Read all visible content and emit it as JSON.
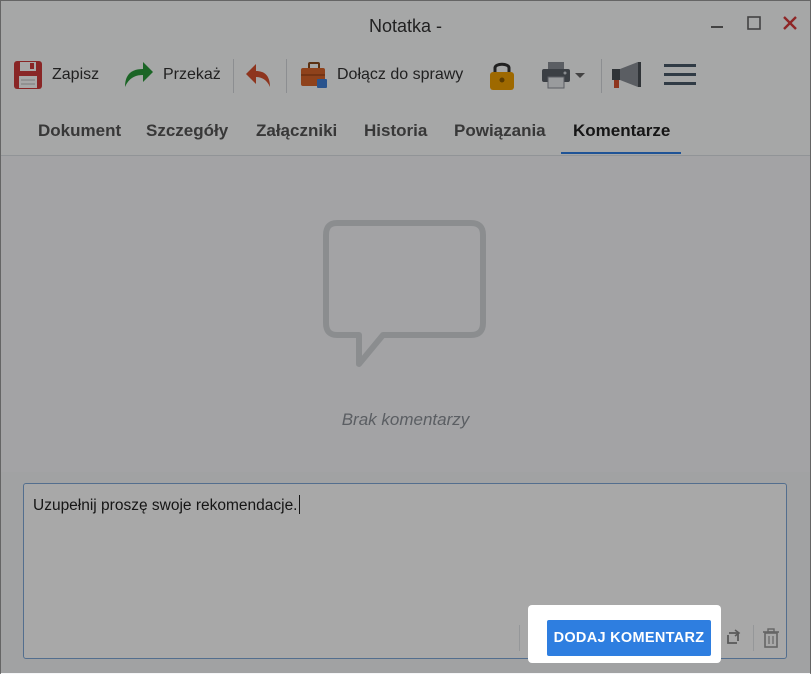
{
  "window": {
    "title": "Notatka -"
  },
  "toolbar": {
    "save_label": "Zapisz",
    "forward_label": "Przekaż",
    "attach_label": "Dołącz do sprawy"
  },
  "tabs": [
    {
      "label": "Dokument"
    },
    {
      "label": "Szczegóły"
    },
    {
      "label": "Załączniki"
    },
    {
      "label": "Historia"
    },
    {
      "label": "Powiązania"
    },
    {
      "label": "Komentarze"
    }
  ],
  "active_tab": "Komentarze",
  "comments": {
    "empty_text": "Brak komentarzy"
  },
  "composer": {
    "text": "Uzupełnij proszę swoje rekomendacje.",
    "add_button_label": "DODAJ KOMENTARZ"
  },
  "colors": {
    "accent": "#2e7ee0",
    "close": "#d83b3b",
    "lock": "#f0a000"
  }
}
